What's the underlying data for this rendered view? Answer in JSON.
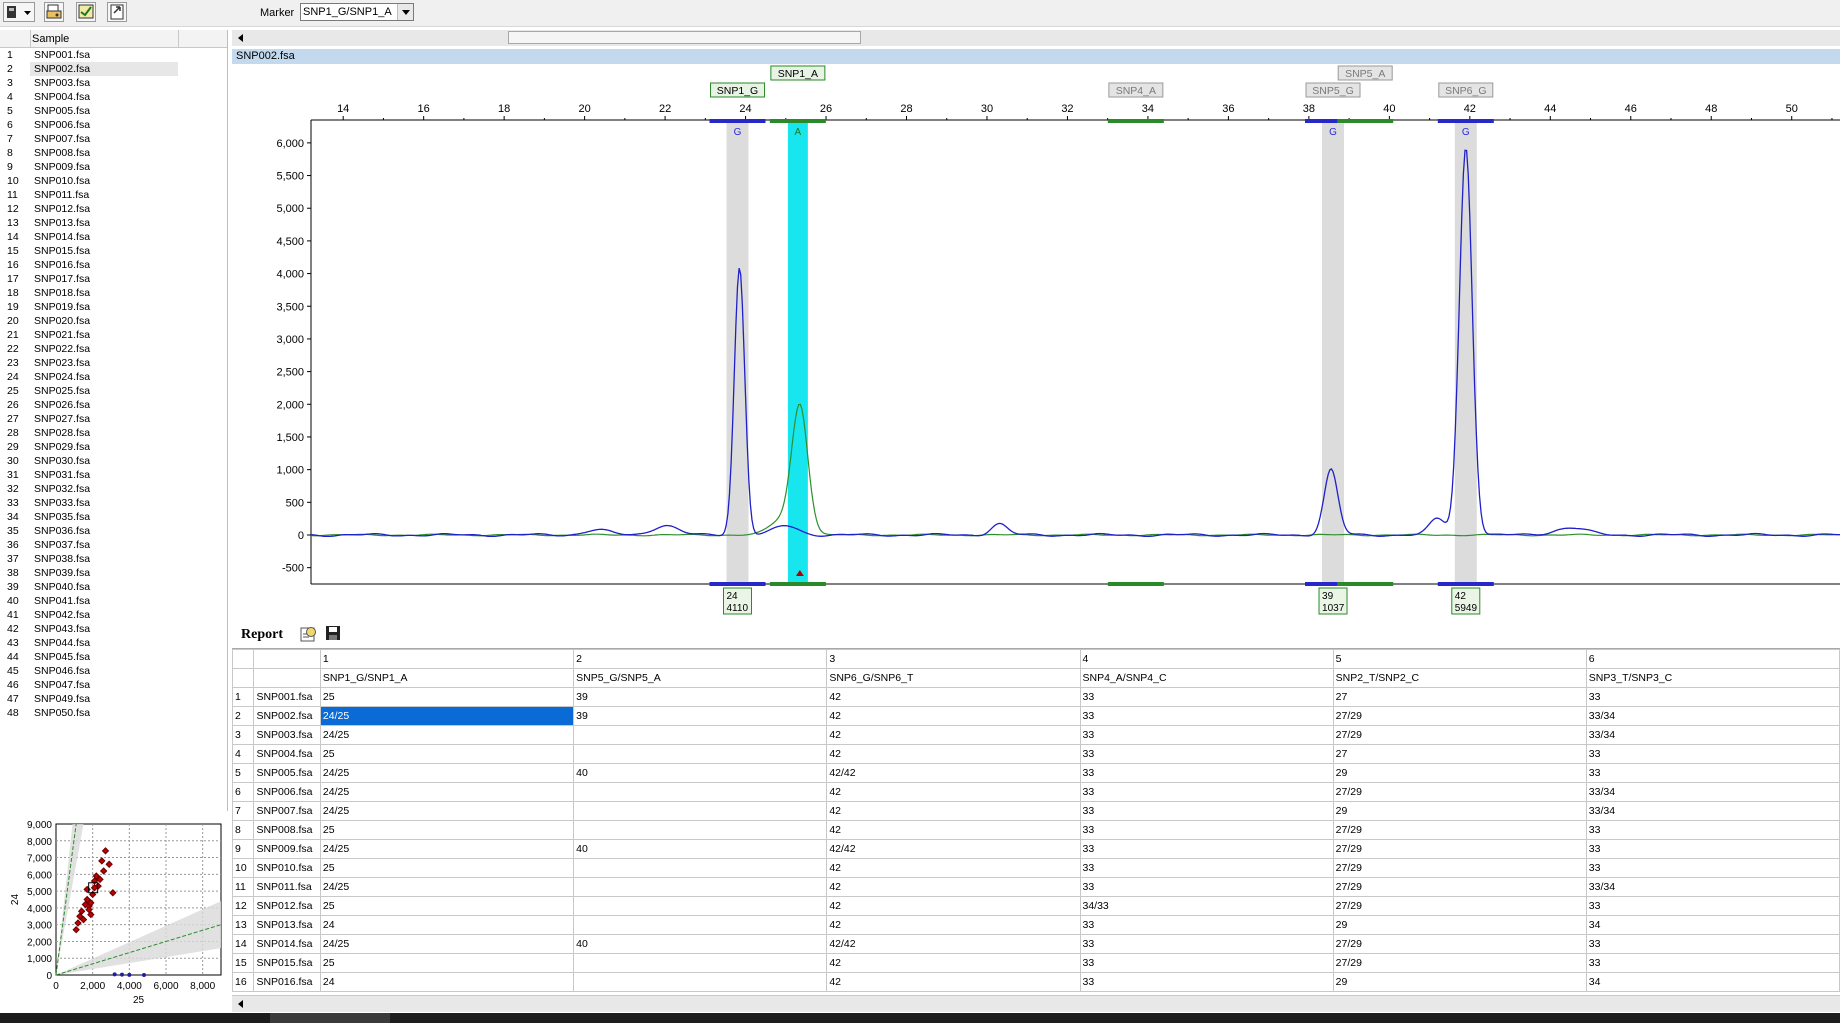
{
  "toolbar": {
    "marker_label": "Marker",
    "marker_value": "SNP1_G/SNP1_A"
  },
  "sample_list": {
    "header": "Sample",
    "selected_index": 2,
    "items": [
      {
        "n": "1",
        "f": "SNP001.fsa"
      },
      {
        "n": "2",
        "f": "SNP002.fsa"
      },
      {
        "n": "3",
        "f": "SNP003.fsa"
      },
      {
        "n": "4",
        "f": "SNP004.fsa"
      },
      {
        "n": "5",
        "f": "SNP005.fsa"
      },
      {
        "n": "6",
        "f": "SNP006.fsa"
      },
      {
        "n": "7",
        "f": "SNP007.fsa"
      },
      {
        "n": "8",
        "f": "SNP008.fsa"
      },
      {
        "n": "9",
        "f": "SNP009.fsa"
      },
      {
        "n": "10",
        "f": "SNP010.fsa"
      },
      {
        "n": "11",
        "f": "SNP011.fsa"
      },
      {
        "n": "12",
        "f": "SNP012.fsa"
      },
      {
        "n": "13",
        "f": "SNP013.fsa"
      },
      {
        "n": "14",
        "f": "SNP014.fsa"
      },
      {
        "n": "15",
        "f": "SNP015.fsa"
      },
      {
        "n": "16",
        "f": "SNP016.fsa"
      },
      {
        "n": "17",
        "f": "SNP017.fsa"
      },
      {
        "n": "18",
        "f": "SNP018.fsa"
      },
      {
        "n": "19",
        "f": "SNP019.fsa"
      },
      {
        "n": "20",
        "f": "SNP020.fsa"
      },
      {
        "n": "21",
        "f": "SNP021.fsa"
      },
      {
        "n": "22",
        "f": "SNP022.fsa"
      },
      {
        "n": "23",
        "f": "SNP023.fsa"
      },
      {
        "n": "24",
        "f": "SNP024.fsa"
      },
      {
        "n": "25",
        "f": "SNP025.fsa"
      },
      {
        "n": "26",
        "f": "SNP026.fsa"
      },
      {
        "n": "27",
        "f": "SNP027.fsa"
      },
      {
        "n": "28",
        "f": "SNP028.fsa"
      },
      {
        "n": "29",
        "f": "SNP029.fsa"
      },
      {
        "n": "30",
        "f": "SNP030.fsa"
      },
      {
        "n": "31",
        "f": "SNP031.fsa"
      },
      {
        "n": "32",
        "f": "SNP032.fsa"
      },
      {
        "n": "33",
        "f": "SNP033.fsa"
      },
      {
        "n": "34",
        "f": "SNP035.fsa"
      },
      {
        "n": "35",
        "f": "SNP036.fsa"
      },
      {
        "n": "36",
        "f": "SNP037.fsa"
      },
      {
        "n": "37",
        "f": "SNP038.fsa"
      },
      {
        "n": "38",
        "f": "SNP039.fsa"
      },
      {
        "n": "39",
        "f": "SNP040.fsa"
      },
      {
        "n": "40",
        "f": "SNP041.fsa"
      },
      {
        "n": "41",
        "f": "SNP042.fsa"
      },
      {
        "n": "42",
        "f": "SNP043.fsa"
      },
      {
        "n": "43",
        "f": "SNP044.fsa"
      },
      {
        "n": "44",
        "f": "SNP045.fsa"
      },
      {
        "n": "45",
        "f": "SNP046.fsa"
      },
      {
        "n": "46",
        "f": "SNP047.fsa"
      },
      {
        "n": "47",
        "f": "SNP049.fsa"
      },
      {
        "n": "48",
        "f": "SNP050.fsa"
      }
    ]
  },
  "scatter_plot": {
    "xlabel": "25",
    "ylabel": "24",
    "x_ticks": [
      "0",
      "2,000",
      "4,000",
      "6,000",
      "8,000"
    ],
    "y_ticks": [
      "0",
      "1,000",
      "2,000",
      "3,000",
      "4,000",
      "5,000",
      "6,000",
      "7,000",
      "8,000",
      "9,000"
    ],
    "red_points": [
      [
        1100,
        2700
      ],
      [
        1200,
        3100
      ],
      [
        1300,
        3500
      ],
      [
        1400,
        3800
      ],
      [
        1500,
        3300
      ],
      [
        1600,
        4200
      ],
      [
        1700,
        4500
      ],
      [
        1800,
        4100
      ],
      [
        1900,
        3600
      ],
      [
        1700,
        5100
      ],
      [
        2000,
        4800
      ],
      [
        2100,
        5600
      ],
      [
        2200,
        5900
      ],
      [
        2300,
        5300
      ],
      [
        1900,
        4300
      ],
      [
        2500,
        6800
      ],
      [
        2600,
        6200
      ],
      [
        2700,
        7400
      ],
      [
        2900,
        6600
      ],
      [
        3100,
        4900
      ],
      [
        2400,
        5700
      ],
      [
        1800,
        3900
      ],
      [
        2100,
        5200
      ]
    ],
    "blue_points": [
      [
        3200,
        40
      ],
      [
        3600,
        20
      ],
      [
        4000,
        10
      ],
      [
        4800,
        0
      ]
    ],
    "colors": {
      "red": "#c00000",
      "blue": "#1b1fa8",
      "green": "#2a8a2a",
      "band": "#d9d9d9"
    }
  },
  "trace": {
    "file_title": "SNP002.fsa",
    "x_ticks": [
      14,
      16,
      18,
      20,
      22,
      24,
      26,
      28,
      30,
      32,
      34,
      36,
      38,
      40,
      42,
      44,
      46,
      48,
      50
    ],
    "y_ticks": [
      "6,000",
      "5,500",
      "5,000",
      "4,500",
      "4,000",
      "3,500",
      "3,000",
      "2,500",
      "2,000",
      "1,500",
      "1,000",
      "500",
      "0",
      "-500"
    ],
    "x_range": [
      13.2,
      51.2
    ],
    "y_range": [
      -750,
      6350
    ],
    "marker_bins": [
      {
        "label": "SNP1_G",
        "x": 23.8,
        "row": 2,
        "style": "green"
      },
      {
        "label": "SNP1_A",
        "x": 25.3,
        "row": 1,
        "style": "green"
      },
      {
        "label": "SNP4_A",
        "x": 33.7,
        "row": 2,
        "style": "gray"
      },
      {
        "label": "SNP5_A",
        "x": 39.4,
        "row": 1,
        "style": "gray"
      },
      {
        "label": "SNP5_G",
        "x": 38.6,
        "row": 2,
        "style": "gray"
      },
      {
        "label": "SNP6_G",
        "x": 41.9,
        "row": 2,
        "style": "gray"
      }
    ],
    "allele_bins": [
      {
        "x": 23.8,
        "letter": "G",
        "color": "blue",
        "highlight": "gray"
      },
      {
        "x": 25.3,
        "letter": "A",
        "color": "green",
        "highlight": "cyan"
      },
      {
        "x": 33.7,
        "letter": "",
        "color": "green",
        "highlight": "none"
      },
      {
        "x": 38.6,
        "letter": "G",
        "color": "blue",
        "highlight": "gray"
      },
      {
        "x": 39.4,
        "letter": "",
        "color": "green",
        "highlight": "none"
      },
      {
        "x": 41.9,
        "letter": "G",
        "color": "blue",
        "highlight": "gray"
      }
    ],
    "peak_labels": [
      {
        "x": 23.8,
        "size": "24",
        "height": "4110"
      },
      {
        "x": 38.6,
        "size": "39",
        "height": "1037"
      },
      {
        "x": 41.9,
        "size": "42",
        "height": "5949"
      }
    ],
    "blue_peaks": [
      [
        23.85,
        4100,
        0.13
      ],
      [
        38.55,
        1000,
        0.17
      ],
      [
        41.9,
        5940,
        0.16
      ],
      [
        20.3,
        80,
        0.3
      ],
      [
        22.0,
        150,
        0.3
      ],
      [
        25.0,
        140,
        0.3
      ],
      [
        30.3,
        170,
        0.2
      ],
      [
        41.2,
        250,
        0.2
      ],
      [
        44.5,
        110,
        0.4
      ]
    ],
    "green_peaks": [
      [
        25.35,
        1940,
        0.2
      ],
      [
        24.9,
        220,
        0.3
      ]
    ],
    "colors": {
      "blue": "#2020c8",
      "green": "#2d8f2d",
      "cyan": "#18e6ee",
      "bin_gray": "#dcdcdc"
    }
  },
  "report": {
    "title": "Report",
    "col_numbers": [
      "1",
      "2",
      "3",
      "4",
      "5",
      "6"
    ],
    "col_headers": [
      "SNP1_G/SNP1_A",
      "SNP5_G/SNP5_A",
      "SNP6_G/SNP6_T",
      "SNP4_A/SNP4_C",
      "SNP2_T/SNP2_C",
      "SNP3_T/SNP3_C"
    ],
    "rows": [
      {
        "n": "1",
        "s": "SNP001.fsa",
        "c": [
          "25",
          "39",
          "42",
          "33",
          "27",
          "33"
        ]
      },
      {
        "n": "2",
        "s": "SNP002.fsa",
        "c": [
          "24/25",
          "39",
          "42",
          "33",
          "27/29",
          "33/34"
        ]
      },
      {
        "n": "3",
        "s": "SNP003.fsa",
        "c": [
          "24/25",
          "",
          "42",
          "33",
          "27/29",
          "33/34"
        ]
      },
      {
        "n": "4",
        "s": "SNP004.fsa",
        "c": [
          "25",
          "",
          "42",
          "33",
          "27",
          "33"
        ]
      },
      {
        "n": "5",
        "s": "SNP005.fsa",
        "c": [
          "24/25",
          "40",
          "42/42",
          "33",
          "29",
          "33"
        ]
      },
      {
        "n": "6",
        "s": "SNP006.fsa",
        "c": [
          "24/25",
          "",
          "42",
          "33",
          "27/29",
          "33/34"
        ]
      },
      {
        "n": "7",
        "s": "SNP007.fsa",
        "c": [
          "24/25",
          "",
          "42",
          "33",
          "29",
          "33/34"
        ]
      },
      {
        "n": "8",
        "s": "SNP008.fsa",
        "c": [
          "25",
          "",
          "42",
          "33",
          "27/29",
          "33"
        ]
      },
      {
        "n": "9",
        "s": "SNP009.fsa",
        "c": [
          "24/25",
          "40",
          "42/42",
          "33",
          "27/29",
          "33"
        ]
      },
      {
        "n": "10",
        "s": "SNP010.fsa",
        "c": [
          "25",
          "",
          "42",
          "33",
          "27/29",
          "33"
        ]
      },
      {
        "n": "11",
        "s": "SNP011.fsa",
        "c": [
          "24/25",
          "",
          "42",
          "33",
          "27/29",
          "33/34"
        ]
      },
      {
        "n": "12",
        "s": "SNP012.fsa",
        "c": [
          "25",
          "",
          "42",
          "34/33",
          "27/29",
          "33"
        ]
      },
      {
        "n": "13",
        "s": "SNP013.fsa",
        "c": [
          "24",
          "",
          "42",
          "33",
          "29",
          "34"
        ]
      },
      {
        "n": "14",
        "s": "SNP014.fsa",
        "c": [
          "24/25",
          "40",
          "42/42",
          "33",
          "27/29",
          "33"
        ]
      },
      {
        "n": "15",
        "s": "SNP015.fsa",
        "c": [
          "25",
          "",
          "42",
          "33",
          "27/29",
          "33"
        ]
      },
      {
        "n": "16",
        "s": "SNP016.fsa",
        "c": [
          "24",
          "",
          "42",
          "33",
          "29",
          "34"
        ]
      }
    ],
    "selected_cell": {
      "row": 1,
      "col": 0
    }
  }
}
